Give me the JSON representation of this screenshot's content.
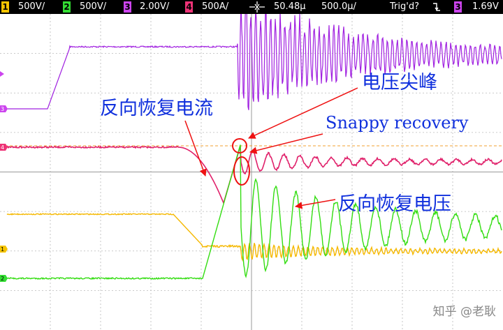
{
  "status_bar": {
    "ch1": {
      "num": "1",
      "scale": "500V/",
      "color": "#f5c400"
    },
    "ch2": {
      "num": "2",
      "scale": "500V/",
      "color": "#33dd33"
    },
    "ch3": {
      "num": "3",
      "scale": "2.00V/",
      "color": "#cc44ee"
    },
    "ch4": {
      "num": "4",
      "scale": "500A/",
      "color": "#ee3377"
    },
    "trigger_icon": "trigger-position-icon",
    "time_offset": "50.48µ",
    "timebase": "500.0µ/",
    "trig_status": "Trig'd?",
    "trig_edge_icon": "falling-edge-icon",
    "trig_source": "3",
    "trig_level": "1.69V"
  },
  "annotations": {
    "reverse_recovery_current": "反向恢复电流",
    "voltage_spike": "电压尖峰",
    "snappy_recovery": "Snappy recovery",
    "reverse_recovery_voltage": "反向恢复电压"
  },
  "colors": {
    "grid": "#b9b9b9",
    "arrow": "#ee1111",
    "annotation_text": "#1030dd",
    "trigger_level_line": "#f0a030",
    "magenta_trace": "#a020e0",
    "pink_trace": "#e0206a",
    "yellow_trace": "#f5b800",
    "green_trace": "#33dd11"
  },
  "watermark": "知乎 @老耿"
}
